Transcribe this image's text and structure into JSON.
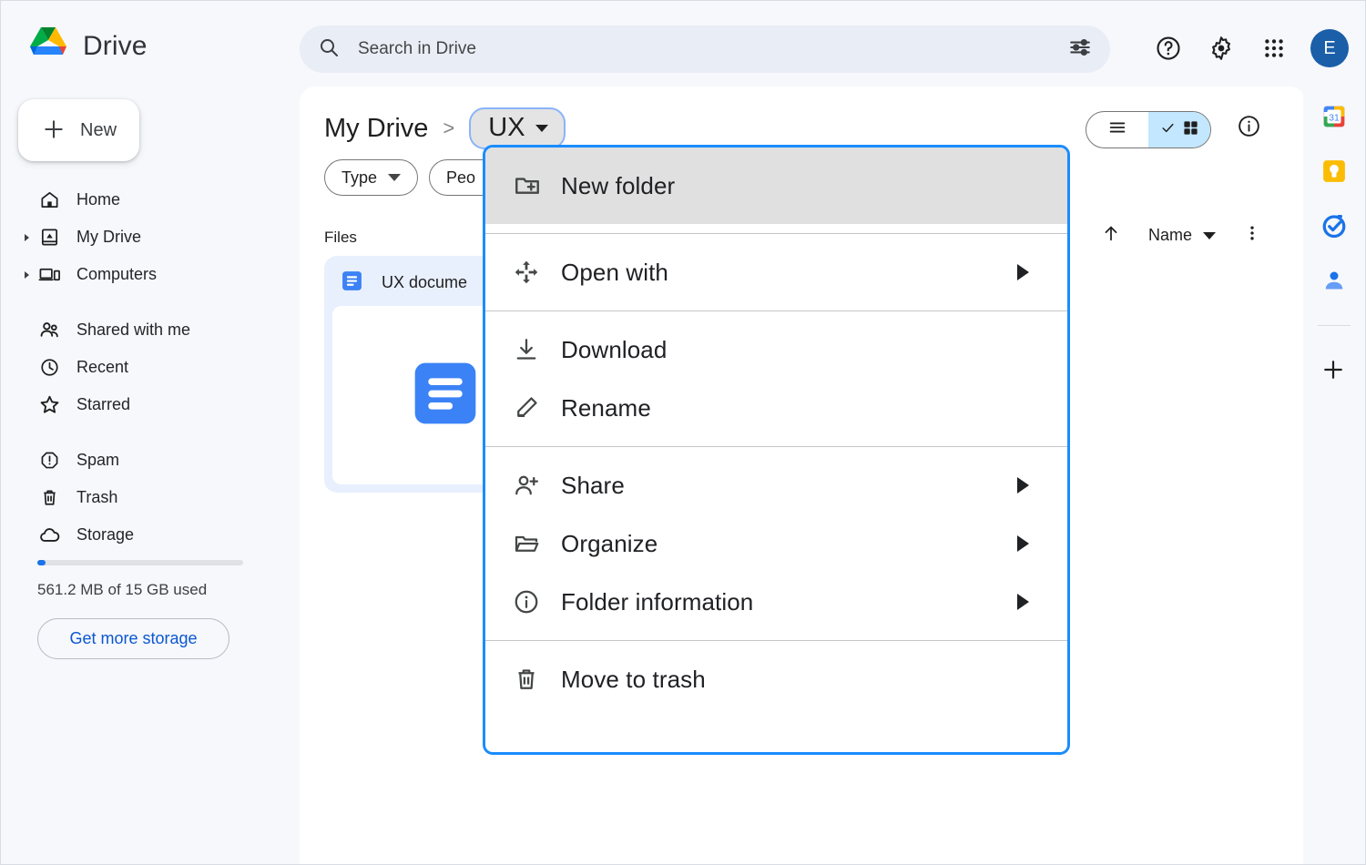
{
  "app": {
    "name": "Drive",
    "logo_icon": "google-drive-logo"
  },
  "topbar": {
    "search": {
      "placeholder": "Search in Drive",
      "value": "",
      "search_icon": "search-icon",
      "filter_icon": "tune-icon"
    },
    "help_icon": "help-circle-icon",
    "settings_icon": "gear-icon",
    "apps_icon": "apps-grid-icon",
    "avatar_initial": "E",
    "avatar_color": "#1a5fa8"
  },
  "sidebar": {
    "new_button": {
      "label": "New",
      "icon": "plus-icon"
    },
    "items": [
      {
        "label": "Home",
        "icon": "home-icon",
        "expandable": false
      },
      {
        "label": "My Drive",
        "icon": "my-drive-icon",
        "expandable": true
      },
      {
        "label": "Computers",
        "icon": "computers-icon",
        "expandable": true
      },
      {
        "label": "Shared with me",
        "icon": "people-icon",
        "expandable": false
      },
      {
        "label": "Recent",
        "icon": "clock-icon",
        "expandable": false
      },
      {
        "label": "Starred",
        "icon": "star-icon",
        "expandable": false
      },
      {
        "label": "Spam",
        "icon": "exclamation-octagon-icon",
        "expandable": false
      },
      {
        "label": "Trash",
        "icon": "trash-icon",
        "expandable": false
      },
      {
        "label": "Storage",
        "icon": "cloud-icon",
        "expandable": false
      }
    ],
    "storage": {
      "usage_text": "561.2 MB of 15 GB used",
      "percent_used": 4,
      "bar_color": "#1a73e8",
      "cta_label": "Get more storage"
    }
  },
  "content": {
    "breadcrumb": {
      "root": "My Drive",
      "separator": ">",
      "current": "UX",
      "current_has_caret": true
    },
    "view_toggle": {
      "list_icon": "list-view-icon",
      "grid_icon": "grid-view-icon",
      "check_icon": "check-icon",
      "active": "grid",
      "active_color": "#c2e7ff"
    },
    "info_icon": "info-circle-icon",
    "filter_chips": [
      {
        "label": "Type",
        "caret": true
      },
      {
        "label": "Peo",
        "caret": true
      }
    ],
    "section_label": "Files",
    "sort": {
      "direction_icon": "arrow-up-icon",
      "field": "Name",
      "caret": true,
      "more_icon": "kebab-menu-icon"
    },
    "files": [
      {
        "name": "UX docume",
        "icon": "google-docs-icon",
        "selected": true
      }
    ]
  },
  "right_rail": {
    "items": [
      {
        "name": "google-calendar-icon",
        "badge": "31"
      },
      {
        "name": "google-keep-icon"
      },
      {
        "name": "google-tasks-icon"
      },
      {
        "name": "google-contacts-icon"
      }
    ],
    "add_icon": "plus-icon"
  },
  "context_menu": {
    "border_color": "#1a8cff",
    "highlight_color": "#e0e0e0",
    "items": [
      {
        "label": "New folder",
        "icon": "new-folder-icon",
        "highlighted": true,
        "submenu": false
      },
      {
        "label": "Open with",
        "icon": "open-with-icon",
        "highlighted": false,
        "submenu": true
      },
      {
        "label": "Download",
        "icon": "download-icon",
        "highlighted": false,
        "submenu": false
      },
      {
        "label": "Rename",
        "icon": "pencil-icon",
        "highlighted": false,
        "submenu": false
      },
      {
        "label": "Share",
        "icon": "person-add-icon",
        "highlighted": false,
        "submenu": true
      },
      {
        "label": "Organize",
        "icon": "folder-move-icon",
        "highlighted": false,
        "submenu": true
      },
      {
        "label": "Folder information",
        "icon": "info-circle-icon",
        "highlighted": false,
        "submenu": true
      },
      {
        "label": "Move to trash",
        "icon": "trash-icon",
        "highlighted": false,
        "submenu": false
      }
    ]
  }
}
